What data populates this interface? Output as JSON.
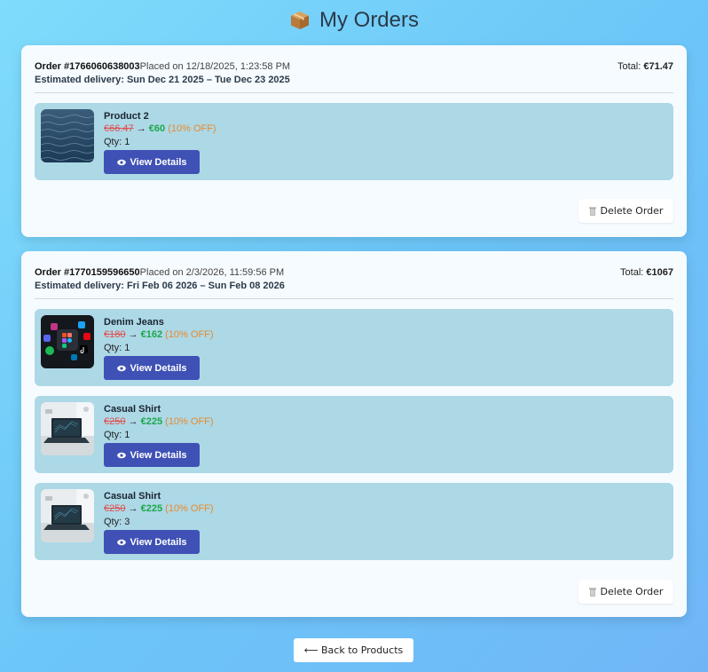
{
  "header": {
    "icon": "package-icon",
    "title": "My Orders"
  },
  "orders": [
    {
      "id_label": "Order #1766060638003",
      "placed": "Placed on 12/18/2025, 1:23:58 PM",
      "delivery_label": "Estimated delivery:",
      "delivery_range": "Sun Dec 21 2025 – Tue Dec 23 2025",
      "total_label": "Total:",
      "total_value": "€71.47",
      "items": [
        {
          "name": "Product 2",
          "old_price": "€66.47",
          "arrow": "→",
          "new_price": "€60",
          "discount": "(10% OFF)",
          "qty": "Qty: 1",
          "details_label": "View Details",
          "thumb": "ocean-thumbnail"
        }
      ],
      "delete_label": "Delete Order"
    },
    {
      "id_label": "Order #1770159596650",
      "placed": "Placed on 2/3/2026, 11:59:56 PM",
      "delivery_label": "Estimated delivery:",
      "delivery_range": "Fri Feb 06 2026 – Sun Feb 08 2026",
      "total_label": "Total:",
      "total_value": "€1067",
      "items": [
        {
          "name": "Denim Jeans",
          "old_price": "€180",
          "arrow": "→",
          "new_price": "€162",
          "discount": "(10% OFF)",
          "qty": "Qty: 1",
          "details_label": "View Details",
          "thumb": "app-icons-thumbnail"
        },
        {
          "name": "Casual Shirt",
          "old_price": "€250",
          "arrow": "→",
          "new_price": "€225",
          "discount": "(10% OFF)",
          "qty": "Qty: 1",
          "details_label": "View Details",
          "thumb": "laptop-desk-thumbnail"
        },
        {
          "name": "Casual Shirt",
          "old_price": "€250",
          "arrow": "→",
          "new_price": "€225",
          "discount": "(10% OFF)",
          "qty": "Qty: 3",
          "details_label": "View Details",
          "thumb": "laptop-desk-thumbnail"
        }
      ],
      "delete_label": "Delete Order"
    }
  ],
  "back_label": "⟵ Back to Products",
  "colors": {
    "card_bg": "#f6fbff",
    "item_bg": "#add8e6",
    "button_primary": "#3f51b5",
    "old_price": "#e05050",
    "new_price": "#1aa84a",
    "discount": "#e98a2a"
  }
}
